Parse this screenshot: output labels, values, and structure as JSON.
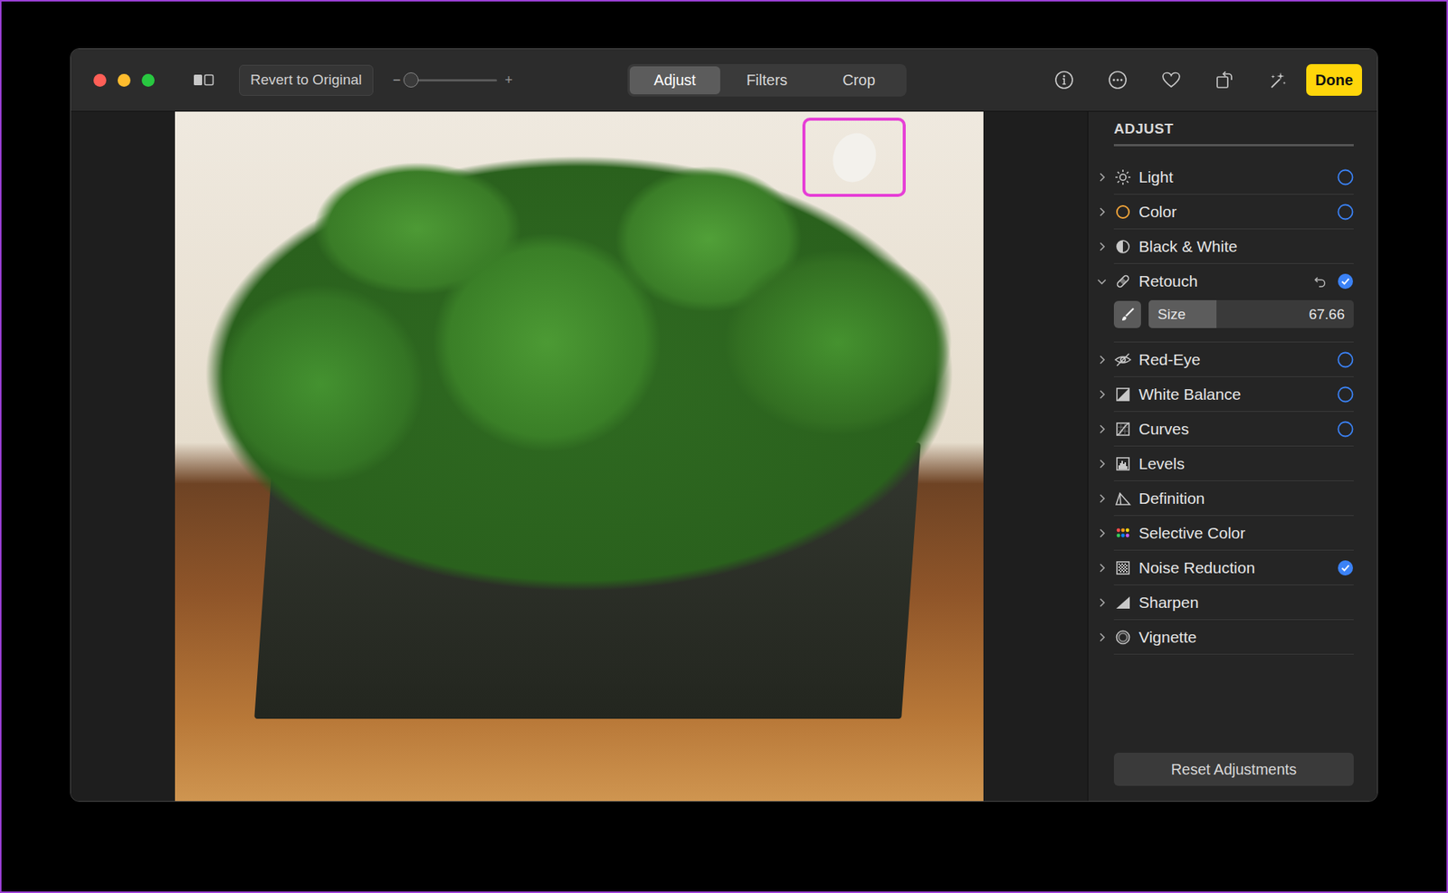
{
  "toolbar": {
    "revert_button": "Revert to Original",
    "zoom": {
      "minus": "−",
      "plus": "+",
      "level": 0.03
    },
    "tabs": [
      {
        "label": "Adjust",
        "selected": true
      },
      {
        "label": "Filters",
        "selected": false
      },
      {
        "label": "Crop",
        "selected": false
      }
    ],
    "done_button": "Done"
  },
  "photo": {
    "highlight_shown": true
  },
  "sidebar": {
    "heading": "ADJUST",
    "items": [
      {
        "label": "Light",
        "expanded": false,
        "has_toggle": true,
        "checked": false,
        "undo": false
      },
      {
        "label": "Color",
        "expanded": false,
        "has_toggle": true,
        "checked": false,
        "undo": false
      },
      {
        "label": "Black & White",
        "expanded": false,
        "has_toggle": false,
        "checked": false,
        "undo": false
      },
      {
        "label": "Retouch",
        "expanded": true,
        "has_toggle": true,
        "checked": true,
        "undo": true,
        "tool": {
          "label": "Size",
          "value": "67.66",
          "level": 0.33
        }
      },
      {
        "label": "Red-Eye",
        "expanded": false,
        "has_toggle": true,
        "checked": false,
        "undo": false
      },
      {
        "label": "White Balance",
        "expanded": false,
        "has_toggle": true,
        "checked": false,
        "undo": false
      },
      {
        "label": "Curves",
        "expanded": false,
        "has_toggle": true,
        "checked": false,
        "undo": false
      },
      {
        "label": "Levels",
        "expanded": false,
        "has_toggle": false,
        "checked": false,
        "undo": false
      },
      {
        "label": "Definition",
        "expanded": false,
        "has_toggle": false,
        "checked": false,
        "undo": false
      },
      {
        "label": "Selective Color",
        "expanded": false,
        "has_toggle": false,
        "checked": false,
        "undo": false
      },
      {
        "label": "Noise Reduction",
        "expanded": false,
        "has_toggle": true,
        "checked": true,
        "undo": false
      },
      {
        "label": "Sharpen",
        "expanded": false,
        "has_toggle": false,
        "checked": false,
        "undo": false
      },
      {
        "label": "Vignette",
        "expanded": false,
        "has_toggle": false,
        "checked": false,
        "undo": false
      }
    ],
    "reset_button": "Reset Adjustments"
  }
}
